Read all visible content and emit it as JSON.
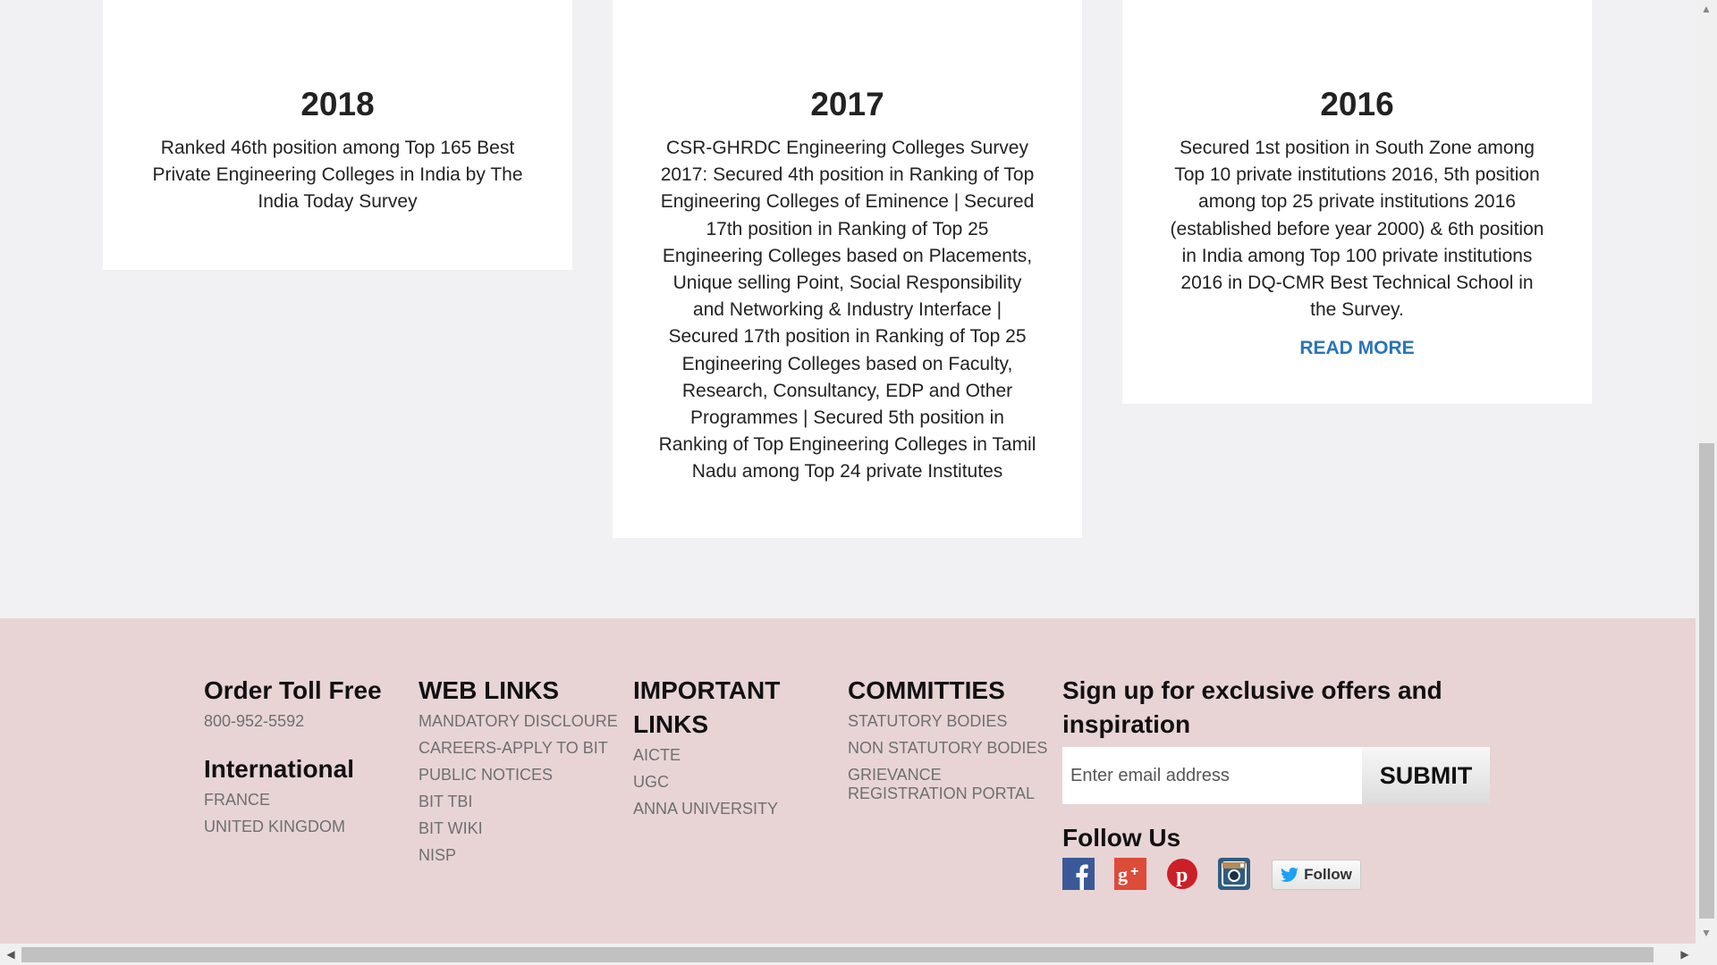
{
  "awards": [
    {
      "year": "2018",
      "text": "Ranked 46th position among Top 165 Best Private Engineering Colleges in India by The India Today Survey"
    },
    {
      "year": "2017",
      "text": "CSR-GHRDC Engineering Colleges Survey 2017: Secured 4th position in Ranking of Top Engineering Colleges of Eminence | Secured 17th position in Ranking of Top 25 Engineering Colleges based on Placements, Unique selling Point, Social Responsibility and Networking & Industry Interface | Secured 17th position in Ranking of Top 25 Engineering Colleges based on Faculty, Research, Consultancy, EDP and Other Programmes | Secured 5th position in Ranking of Top Engineering Colleges in Tamil Nadu among Top 24 private Institutes"
    },
    {
      "year": "2016",
      "text": "Secured 1st position in South Zone among Top 10 private institutions 2016, 5th position among top 25 private institutions 2016 (established before year 2000) & 6th position in India among Top 100 private institutions 2016 in DQ-CMR Best Technical School in the Survey.",
      "read_more": "READ MORE"
    }
  ],
  "footer": {
    "order": {
      "title": "Order Toll Free",
      "phone": "800-952-5592",
      "intl_title": "International",
      "countries": [
        "FRANCE",
        "UNITED KINGDOM"
      ]
    },
    "web_links": {
      "title": "WEB LINKS",
      "items": [
        "MANDATORY DISCLOURE",
        "CAREERS-APPLY TO BIT",
        "PUBLIC NOTICES",
        "BIT TBI",
        "BIT WIKI",
        "NISP"
      ]
    },
    "important_links": {
      "title": "IMPORTANT LINKS",
      "items": [
        "AICTE",
        "UGC",
        "ANNA UNIVERSITY"
      ]
    },
    "committees": {
      "title": "COMMITTIES",
      "items": [
        "STATUTORY BODIES",
        "NON STATUTORY BODIES",
        "GRIEVANCE REGISTRATION PORTAL"
      ]
    },
    "signup": {
      "title": "Sign up for exclusive offers and inspiration",
      "placeholder": "Enter email address",
      "submit": "SUBMIT",
      "follow_title": "Follow Us",
      "social_icons": [
        "facebook-icon",
        "google-plus-icon",
        "pinterest-icon",
        "instagram-icon"
      ],
      "twitter_follow": "Follow"
    },
    "colors": {
      "background": "#e8d4d5",
      "link": "#6f6f6f",
      "read_more": "#2a74b8"
    }
  }
}
